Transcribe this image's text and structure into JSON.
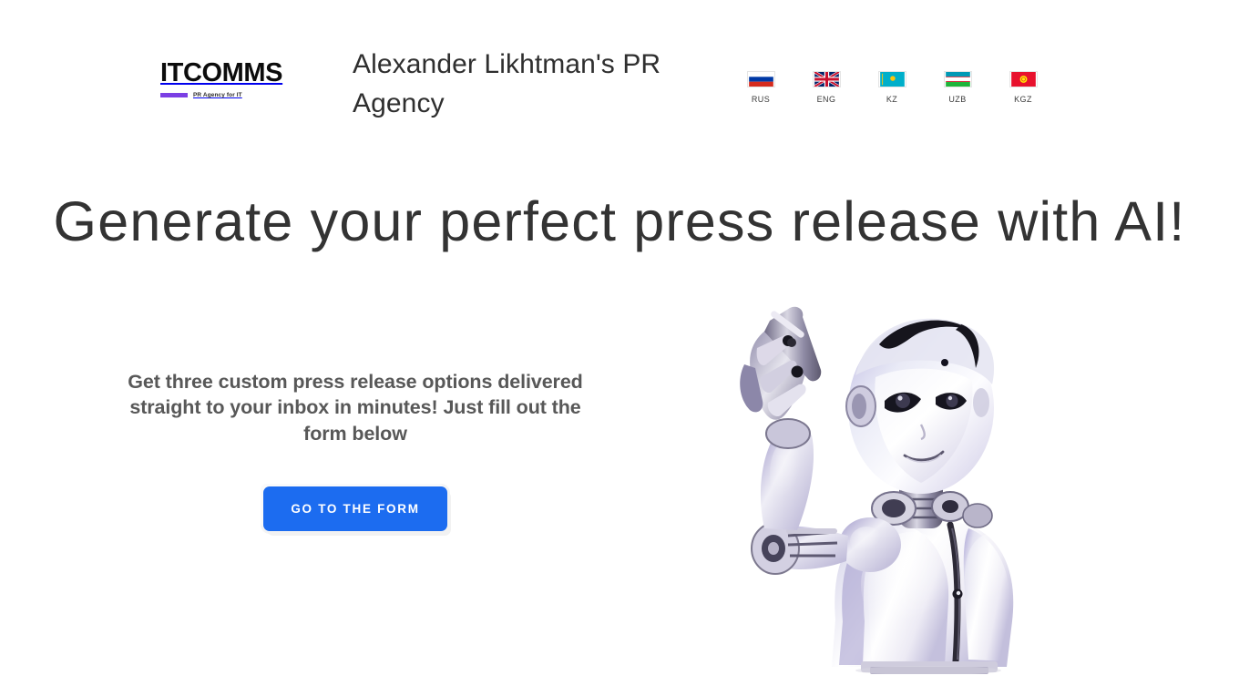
{
  "header": {
    "logo": {
      "wordmark": "ITCOMMS",
      "tagline": "PR Agency for IT",
      "bar_color": "#7b3fe4"
    },
    "site_title": "Alexander Likhtman's PR Agency",
    "languages": [
      {
        "code": "RUS",
        "name": "russia-flag-icon"
      },
      {
        "code": "ENG",
        "name": "united-kingdom-flag-icon"
      },
      {
        "code": "KZ",
        "name": "kazakhstan-flag-icon"
      },
      {
        "code": "UZB",
        "name": "uzbekistan-flag-icon"
      },
      {
        "code": "KGZ",
        "name": "kyrgyzstan-flag-icon"
      }
    ]
  },
  "hero": {
    "heading": "Generate your perfect press release with AI!",
    "subheading": "Get three custom press release options delivered straight to your inbox in minutes! Just fill out the form below",
    "cta_label": "Go to the form",
    "illustration": "ai-robot-pointing-illustration"
  },
  "colors": {
    "accent_blue": "#1c6cf0",
    "heading": "#333333",
    "subheading": "#585858",
    "brand_purple": "#7b3fe4",
    "background": "#ffffff"
  }
}
